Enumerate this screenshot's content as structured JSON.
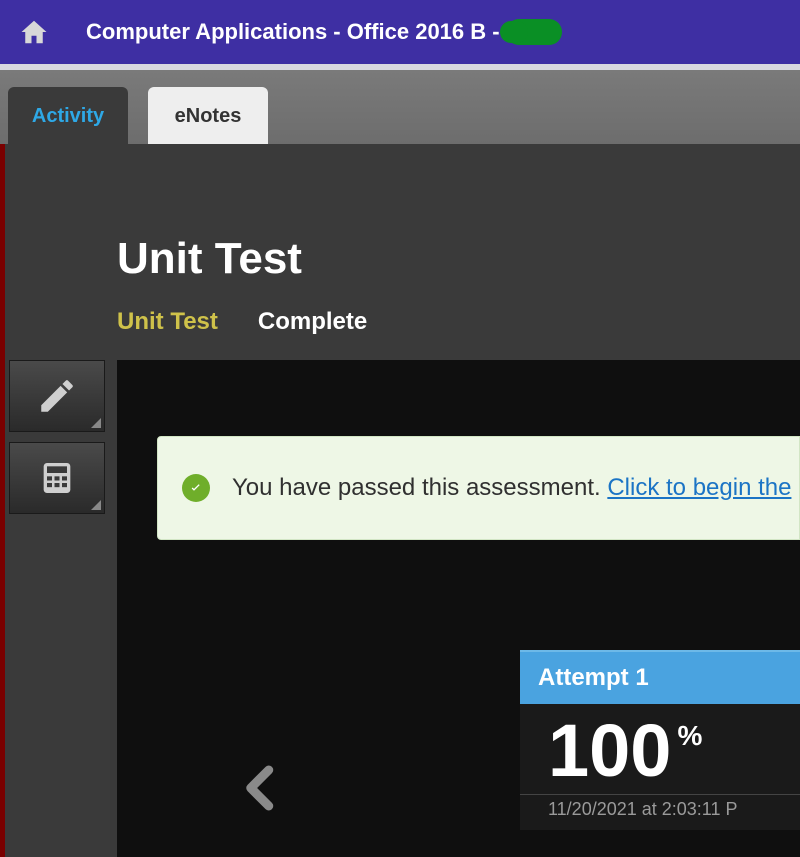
{
  "header": {
    "course_title": "Computer Applications - Office 2016 B -"
  },
  "tabs": {
    "activity": "Activity",
    "enotes": "eNotes"
  },
  "page": {
    "title": "Unit Test",
    "subtitle": "Unit Test",
    "status": "Complete"
  },
  "banner": {
    "text": "You have passed this assessment. ",
    "link": "Click to begin the "
  },
  "attempt": {
    "label": "Attempt 1",
    "score": "100",
    "percent": "%",
    "timestamp": "11/20/2021 at 2:03:11 P"
  }
}
